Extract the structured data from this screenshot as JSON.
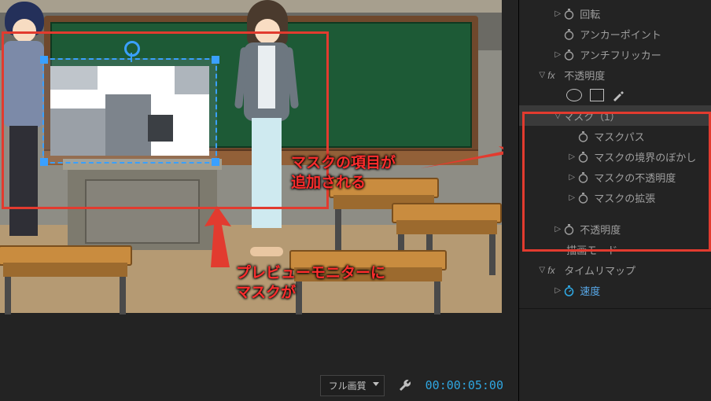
{
  "panel": {
    "rotation": "回転",
    "anchor_point": "アンカーポイント",
    "anti_flicker": "アンチフリッカー",
    "opacity_group": "不透明度",
    "mask_group": "マスク（1）",
    "mask_path": "マスクパス",
    "mask_feather": "マスクの境界のぼかし",
    "mask_opacity": "マスクの不透明度",
    "mask_expansion": "マスクの拡張",
    "opacity": "不透明度",
    "blend_mode": "描画モード",
    "time_remap_group": "タイムリマップ",
    "speed": "速度"
  },
  "bottombar": {
    "quality": "フル画質",
    "timecode": "00:00:05:00"
  },
  "annotations": {
    "a1_l1": "マスクの項目が",
    "a1_l2": "追加される",
    "a2_l1": "プレビューモニターに",
    "a2_l2": "マスクが"
  }
}
